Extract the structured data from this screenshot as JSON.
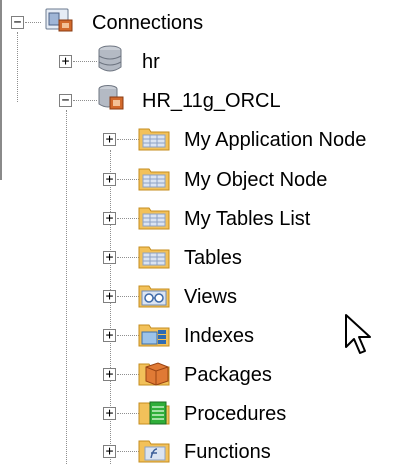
{
  "tree": {
    "root": {
      "label": "Connections",
      "expander": "−",
      "icon": "connections-icon"
    },
    "connections": [
      {
        "label": "hr",
        "expander": "+",
        "icon": "database-icon"
      },
      {
        "label": "HR_11g_ORCL",
        "expander": "−",
        "icon": "connection-icon"
      }
    ],
    "nodes": [
      {
        "label": "My Application Node",
        "expander": "+",
        "icon": "folder-icon"
      },
      {
        "label": "My Object Node",
        "expander": "+",
        "icon": "folder-icon"
      },
      {
        "label": "My Tables List",
        "expander": "+",
        "icon": "folder-icon"
      },
      {
        "label": "Tables",
        "expander": "+",
        "icon": "tables-folder-icon"
      },
      {
        "label": "Views",
        "expander": "+",
        "icon": "views-folder-icon"
      },
      {
        "label": "Indexes",
        "expander": "+",
        "icon": "indexes-folder-icon"
      },
      {
        "label": "Packages",
        "expander": "+",
        "icon": "packages-folder-icon"
      },
      {
        "label": "Procedures",
        "expander": "+",
        "icon": "procedures-folder-icon"
      },
      {
        "label": "Functions",
        "expander": "+",
        "icon": "functions-folder-icon"
      }
    ]
  },
  "colors": {
    "folder": "#f2c15a",
    "folder_dark": "#c58d1f",
    "tree_line": "#8f8f8f",
    "expander_border": "#7f7f7f"
  },
  "cursor": {
    "icon": "mouse-pointer-icon"
  }
}
